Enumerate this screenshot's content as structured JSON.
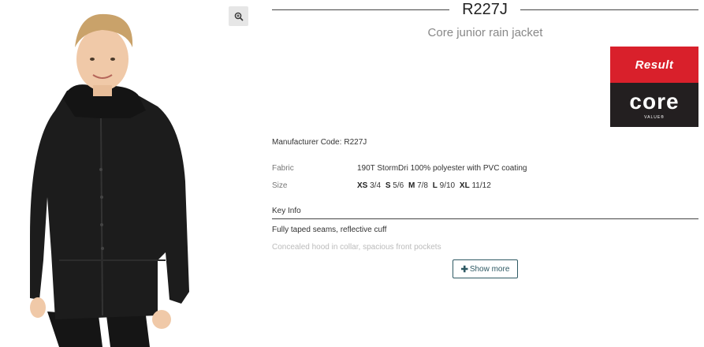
{
  "product": {
    "sku": "R227J",
    "subtitle": "Core junior rain jacket",
    "manufacturer_label": "Manufacturer Code:",
    "manufacturer_code": "R227J"
  },
  "brand_logo": {
    "top_text": "Result",
    "main_text": "core",
    "sub_text": "VALUE®",
    "colors": {
      "top": "#d9202b",
      "bottom": "#231f20"
    }
  },
  "image": {
    "zoom_icon": "zoom-in-icon",
    "jacket_color": "#1c1c1c"
  },
  "specs": {
    "fabric_label": "Fabric",
    "fabric_value": "190T StormDri 100% polyester with PVC coating",
    "size_label": "Size",
    "sizes": [
      {
        "code": "XS",
        "range": "3/4"
      },
      {
        "code": "S",
        "range": "5/6"
      },
      {
        "code": "M",
        "range": "7/8"
      },
      {
        "code": "L",
        "range": "9/10"
      },
      {
        "code": "XL",
        "range": "11/12"
      }
    ]
  },
  "key_info": {
    "title": "Key Info",
    "lines": [
      "Fully taped seams, reflective cuff",
      "Concealed hood in collar, spacious front pockets"
    ],
    "show_more_label": "Show more",
    "show_more_icon": "plus-icon"
  }
}
